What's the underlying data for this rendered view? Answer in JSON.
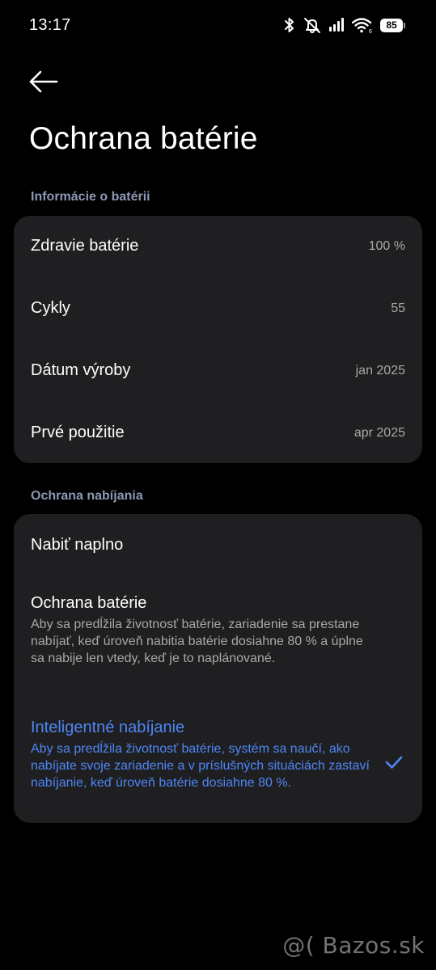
{
  "status_bar": {
    "time": "13:17",
    "battery_level": "85",
    "icons": [
      "bluetooth-icon",
      "mute-icon",
      "signal-icon",
      "wifi-icon",
      "battery-icon"
    ]
  },
  "header": {
    "title": "Ochrana batérie"
  },
  "battery_info": {
    "section_title": "Informácie o batérii",
    "rows": [
      {
        "label": "Zdravie batérie",
        "value": "100 %"
      },
      {
        "label": "Cykly",
        "value": "55"
      },
      {
        "label": "Dátum výroby",
        "value": "jan 2025"
      },
      {
        "label": "Prvé použitie",
        "value": "apr 2025"
      }
    ]
  },
  "charging_protection": {
    "section_title": "Ochrana nabíjania",
    "options": [
      {
        "title": "Nabiť naplno",
        "description": "",
        "selected": false
      },
      {
        "title": "Ochrana batérie",
        "description": "Aby sa predĺžila životnosť batérie, zariadenie sa prestane nabíjať, keď úroveň nabitia batérie dosiahne 80 % a úplne sa nabije len vtedy, keď je to naplánované.",
        "selected": false
      },
      {
        "title": "Inteligentné nabíjanie",
        "description": "Aby sa predĺžila životnosť batérie, systém sa naučí, ako nabíjate svoje zariadenie a v príslušných situáciách zastaví nabíjanie, keď úroveň batérie dosiahne 80 %.",
        "selected": true
      }
    ]
  },
  "watermark": {
    "text": "@( Bazos.sk"
  },
  "colors": {
    "background": "#000000",
    "card": "#1f1f21",
    "section_header": "#8e97b3",
    "accent": "#4e86f5",
    "secondary_text": "#a8a8a8"
  }
}
